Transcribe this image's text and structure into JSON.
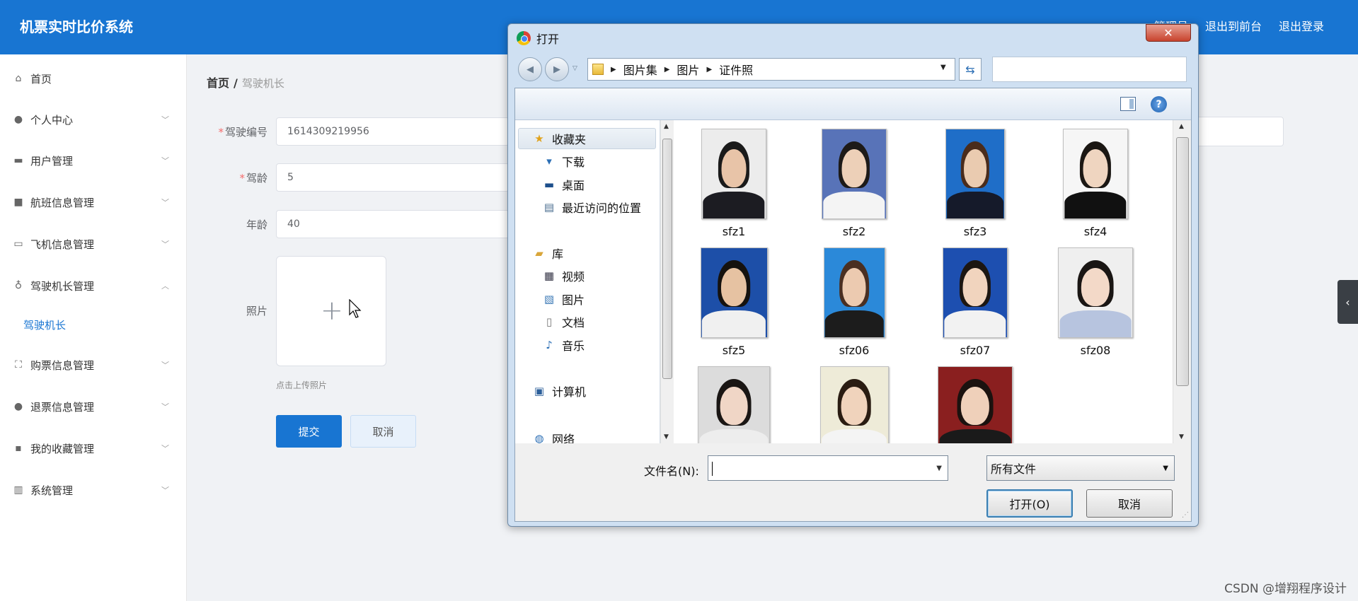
{
  "header": {
    "brand": "机票实时比价系统",
    "nav": [
      "管理员",
      "退出到前台",
      "退出登录"
    ]
  },
  "sidebar": {
    "items": [
      {
        "label": "首页",
        "icon": "home-icon",
        "arrow": ""
      },
      {
        "label": "个人中心",
        "icon": "user-icon",
        "arrow": "﹀"
      },
      {
        "label": "用户管理",
        "icon": "users-icon",
        "arrow": "﹀"
      },
      {
        "label": "航班信息管理",
        "icon": "briefcase-icon",
        "arrow": "﹀"
      },
      {
        "label": "飞机信息管理",
        "icon": "chat-icon",
        "arrow": "﹀"
      },
      {
        "label": "驾驶机长管理",
        "icon": "mic-icon",
        "arrow": "︿"
      },
      {
        "label": "购票信息管理",
        "icon": "fullscreen-icon",
        "arrow": "﹀"
      },
      {
        "label": "退票信息管理",
        "icon": "person-icon",
        "arrow": "﹀"
      },
      {
        "label": "我的收藏管理",
        "icon": "message-icon",
        "arrow": "﹀"
      },
      {
        "label": "系统管理",
        "icon": "bar-chart-icon",
        "arrow": "﹀"
      }
    ],
    "sub_item": "驾驶机长"
  },
  "breadcrumb": {
    "home": "首页",
    "sep": "/",
    "current": "驾驶机长"
  },
  "form": {
    "fields": [
      {
        "label": "驾驶编号",
        "required": "*",
        "value": "1614309219956"
      },
      {
        "label": "驾龄",
        "required": "*",
        "value": "5"
      },
      {
        "label": "年龄",
        "required": "",
        "value": "40"
      }
    ],
    "photo_label": "照片",
    "upload_plus": "+",
    "upload_tip": "点击上传照片",
    "submit": "提交",
    "cancel": "取消"
  },
  "right_tab_glyph": "‹",
  "watermark": "CSDN @增翔程序设计",
  "dialog": {
    "title": "打开",
    "close": "✕",
    "address": [
      "图片集",
      "图片",
      "证件照"
    ],
    "sidebar_groups": [
      {
        "label": "收藏夹",
        "icon": "star-icon",
        "glyph": "★",
        "color": "#e0a21b"
      },
      {
        "label": "下载",
        "icon": "download-folder-icon",
        "glyph": "▾",
        "color": "#2c6fb5"
      },
      {
        "label": "桌面",
        "icon": "desktop-icon",
        "glyph": "▬",
        "color": "#1d4f8c"
      },
      {
        "label": "最近访问的位置",
        "icon": "recent-places-icon",
        "glyph": "▤",
        "color": "#4a6d8f"
      },
      {
        "label": "库",
        "icon": "library-icon",
        "glyph": "▰",
        "color": "#d9a63a"
      },
      {
        "label": "视频",
        "icon": "video-icon",
        "glyph": "▦",
        "color": "#334"
      },
      {
        "label": "图片",
        "icon": "pictures-icon",
        "glyph": "▧",
        "color": "#3a78b5"
      },
      {
        "label": "文档",
        "icon": "documents-icon",
        "glyph": "▯",
        "color": "#777"
      },
      {
        "label": "音乐",
        "icon": "music-icon",
        "glyph": "♪",
        "color": "#2c6fb5"
      },
      {
        "label": "计算机",
        "icon": "computer-icon",
        "glyph": "▣",
        "color": "#2c5f9a"
      },
      {
        "label": "网络",
        "icon": "network-icon",
        "glyph": "◍",
        "color": "#2c6fb5"
      }
    ],
    "files": [
      {
        "name": "sfz1",
        "bg": "#ececec",
        "hair": "#1a1a1a",
        "skin": "#e8c4a8",
        "cloth": "#1c1c22"
      },
      {
        "name": "sfz2",
        "bg": "#5873b8",
        "hair": "#1d1a18",
        "skin": "#edd0b8",
        "cloth": "#f4f4f4"
      },
      {
        "name": "sfz3",
        "bg": "#1f6ec8",
        "hair": "#4a2c1c",
        "skin": "#eacbb0",
        "cloth": "#151a2a"
      },
      {
        "name": "sfz4",
        "bg": "#f6f6f6",
        "hair": "#1b1713",
        "skin": "#efd5c0",
        "cloth": "#111111"
      },
      {
        "name": "sfz5",
        "bg": "#1d4fa8",
        "hair": "#15120f",
        "skin": "#e6c2a2",
        "cloth": "#f0f0f0"
      },
      {
        "name": "sfz06",
        "bg": "#2b89d9",
        "hair": "#4a2f22",
        "skin": "#eccab0",
        "cloth": "#1c1c1c"
      },
      {
        "name": "sfz07",
        "bg": "#1d4fb0",
        "hair": "#1c1612",
        "skin": "#f1d4be",
        "cloth": "#f2f2f2"
      },
      {
        "name": "sfz08",
        "bg": "#efefef",
        "hair": "#1a1614",
        "skin": "#f3d9c8",
        "cloth": "#b7c4df"
      },
      {
        "name": "",
        "bg": "#dcdcdc",
        "hair": "#1a1614",
        "skin": "#f0d6c6",
        "cloth": "#ededed"
      },
      {
        "name": "",
        "bg": "#eeebd8",
        "hair": "#2a1c12",
        "skin": "#f0d3bc",
        "cloth": "#f4f4f4"
      },
      {
        "name": "",
        "bg": "#8a1f1f",
        "hair": "#1b120f",
        "skin": "#efd0ba",
        "cloth": "#1a1a1a"
      }
    ],
    "filename_label": "文件名(N):",
    "filename_value": "",
    "filetype": "所有文件",
    "open": "打开(O)",
    "cancel": "取消"
  }
}
